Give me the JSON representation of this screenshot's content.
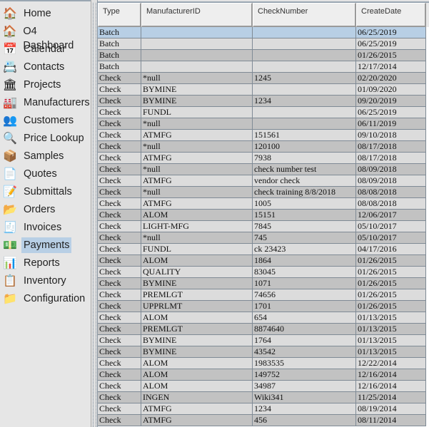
{
  "sidebar": {
    "selected": "Payments",
    "items": [
      {
        "label": "Home",
        "icon": "home-icon",
        "glyph": "🏠"
      },
      {
        "label": "O4 Dashboard",
        "icon": "dashboard-icon",
        "glyph": "🏠"
      },
      {
        "label": "Calendar",
        "icon": "calendar-icon",
        "glyph": "📅"
      },
      {
        "label": "Contacts",
        "icon": "contact-card-icon",
        "glyph": "📇"
      },
      {
        "label": "Projects",
        "icon": "building-icon",
        "glyph": "🏛"
      },
      {
        "label": "Manufacturers",
        "icon": "factory-icon",
        "glyph": "🏭"
      },
      {
        "label": "Customers",
        "icon": "customer-icon",
        "glyph": "👥"
      },
      {
        "label": "Price Lookup",
        "icon": "price-lookup-icon",
        "glyph": "🔍"
      },
      {
        "label": "Samples",
        "icon": "samples-icon",
        "glyph": "📦"
      },
      {
        "label": "Quotes",
        "icon": "quotes-icon",
        "glyph": "📄"
      },
      {
        "label": "Submittals",
        "icon": "submittals-icon",
        "glyph": "📝"
      },
      {
        "label": "Orders",
        "icon": "orders-icon",
        "glyph": "📂"
      },
      {
        "label": "Invoices",
        "icon": "invoices-icon",
        "glyph": "🧾"
      },
      {
        "label": "Payments",
        "icon": "payment-hand-icon",
        "glyph": "💵"
      },
      {
        "label": "Reports",
        "icon": "reports-icon",
        "glyph": "📊"
      },
      {
        "label": "Inventory",
        "icon": "inventory-icon",
        "glyph": "📋"
      },
      {
        "label": "Configuration",
        "icon": "folder-icon",
        "glyph": "📁"
      }
    ]
  },
  "table": {
    "columns": [
      "Type",
      "ManufacturerID",
      "CheckNumber",
      "CreateDate"
    ],
    "selected_row": 0,
    "rows": [
      [
        "Batch",
        "",
        "",
        "06/25/2019"
      ],
      [
        "Batch",
        "",
        "",
        "06/25/2019"
      ],
      [
        "Batch",
        "",
        "",
        "01/26/2015"
      ],
      [
        "Batch",
        "",
        "",
        "12/17/2014"
      ],
      [
        "Check",
        "*null",
        "1245",
        "02/20/2020"
      ],
      [
        "Check",
        "BYMINE",
        "",
        "01/09/2020"
      ],
      [
        "Check",
        "BYMINE",
        "1234",
        "09/20/2019"
      ],
      [
        "Check",
        "FUNDL",
        "",
        "06/25/2019"
      ],
      [
        "Check",
        "*null",
        "",
        "06/11/2019"
      ],
      [
        "Check",
        "ATMFG",
        "151561",
        "09/10/2018"
      ],
      [
        "Check",
        "*null",
        "120100",
        "08/17/2018"
      ],
      [
        "Check",
        "ATMFG",
        "7938",
        "08/17/2018"
      ],
      [
        "Check",
        "*null",
        "check number test",
        "08/09/2018"
      ],
      [
        "Check",
        "ATMFG",
        "vendor check",
        "08/09/2018"
      ],
      [
        "Check",
        "*null",
        "check training 8/8/2018",
        "08/08/2018"
      ],
      [
        "Check",
        "ATMFG",
        "1005",
        "08/08/2018"
      ],
      [
        "Check",
        "ALOM",
        "15151",
        "12/06/2017"
      ],
      [
        "Check",
        "LIGHT-MFG",
        "7845",
        "05/10/2017"
      ],
      [
        "Check",
        "*null",
        "745",
        "05/10/2017"
      ],
      [
        "Check",
        "FUNDL",
        "ck 23423",
        "04/17/2016"
      ],
      [
        "Check",
        "ALOM",
        "1864",
        "01/26/2015"
      ],
      [
        "Check",
        "QUALITY",
        "83045",
        "01/26/2015"
      ],
      [
        "Check",
        "BYMINE",
        "1071",
        "01/26/2015"
      ],
      [
        "Check",
        "PREMLGT",
        "74656",
        "01/26/2015"
      ],
      [
        "Check",
        "UPPRLMT",
        "1701",
        "01/26/2015"
      ],
      [
        "Check",
        "ALOM",
        "654",
        "01/13/2015"
      ],
      [
        "Check",
        "PREMLGT",
        "8874640",
        "01/13/2015"
      ],
      [
        "Check",
        "BYMINE",
        "1764",
        "01/13/2015"
      ],
      [
        "Check",
        "BYMINE",
        "43542",
        "01/13/2015"
      ],
      [
        "Check",
        "ALOM",
        "1983535",
        "12/22/2014"
      ],
      [
        "Check",
        "ALOM",
        "149752",
        "12/16/2014"
      ],
      [
        "Check",
        "ALOM",
        "34987",
        "12/16/2014"
      ],
      [
        "Check",
        "INGEN",
        "Wiki341",
        "11/25/2014"
      ],
      [
        "Check",
        "ATMFG",
        "1234",
        "08/19/2014"
      ],
      [
        "Check",
        "ATMFG",
        "456",
        "08/11/2014"
      ]
    ]
  }
}
